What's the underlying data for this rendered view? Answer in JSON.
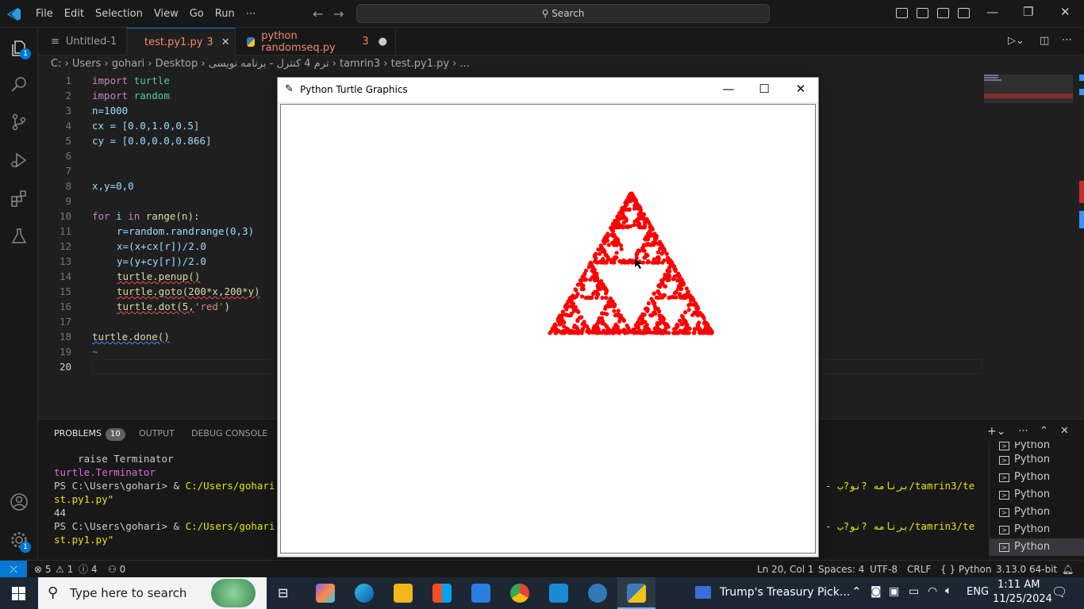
{
  "menu": [
    "File",
    "Edit",
    "Selection",
    "View",
    "Go",
    "Run",
    "⋯"
  ],
  "search": {
    "label": "Search"
  },
  "activity_badges": {
    "explorer": "1",
    "settings": "1"
  },
  "tabs": [
    {
      "label": "Untitled-1",
      "suffix": ""
    },
    {
      "label": "test.py1.py",
      "suffix": "3"
    },
    {
      "label": "python randomseq.py",
      "suffix": "3"
    }
  ],
  "breadcrumb": "C: › Users › gohari › Desktop › ترم 4 کنترل - برنامه نویسی › tamrin3 › test.py1.py › ...",
  "editor": {
    "line_numbers": [
      "1",
      "2",
      "3",
      "4",
      "5",
      "6",
      "7",
      "8",
      "9",
      "10",
      "11",
      "12",
      "13",
      "14",
      "15",
      "16",
      "17",
      "18",
      "19",
      "20"
    ],
    "lines": {
      "l1_kw": "import",
      "l1_mod": "turtle",
      "l2_kw": "import",
      "l2_mod": "random",
      "l3": "n=1000",
      "l4": "cx = [0.0,1.0,0.5]",
      "l5": "cy = [0.0,0.0,0.866]",
      "l8": "x,y=0,0",
      "l10_kw": "for",
      "l10_var": "i",
      "l10_in": "in",
      "l10_rest": "range(n):",
      "l11": "r=random.randrange(0,3)",
      "l12": "x=(x+cx[r])/2.0",
      "l13": "y=(y+cy[r])/2.0",
      "l14": "turtle.penup()",
      "l15": "turtle.goto(200*x,200*y)",
      "l16a": "turtle.dot(5,",
      "l16b": "'red'",
      "l16c": ")",
      "l18": "turtle.done()",
      "l19": "~"
    }
  },
  "panel": {
    "tabs": [
      "PROBLEMS",
      "OUTPUT",
      "DEBUG CONSOLE"
    ],
    "problems_count": "10",
    "terminal_lines": [
      "    raise Terminator",
      "turtle.Terminator",
      "PS C:\\Users\\gohari> & ",
      "C:/Users/gohari",
      "st.py1.py\"",
      "44",
      "PS C:\\Users\\gohari> & ",
      "C:/Users/gohari",
      "st.py1.py\""
    ],
    "terminal_right": "- برنامه ?نو?ب/tamrin3/te",
    "terminal_list": [
      "Python",
      "Python",
      "Python",
      "Python",
      "Python",
      "Python",
      "Python"
    ]
  },
  "statusbar": {
    "errors": "⊗ 5",
    "warnings": "⚠ 1",
    "infos": "ⓘ 4",
    "ports": "⚇ 0",
    "position": "Ln 20, Col 1",
    "spaces": "Spaces: 4",
    "encoding": "UTF-8",
    "eol": "CRLF",
    "language": "{ } Python",
    "interpreter": "3.13.0 64-bit"
  },
  "taskbar": {
    "search_placeholder": "Type here to search",
    "news": "Trump's Treasury Pick...",
    "lang": "ENG",
    "time": "1:11 AM",
    "date": "11/25/2024"
  },
  "turtle_window": {
    "title": "Python Turtle Graphics",
    "dot_color": "#ff0000",
    "dot_count": 1000
  },
  "colors": {
    "accent": "#0078d4",
    "editor_bg": "#1f1f1f"
  }
}
